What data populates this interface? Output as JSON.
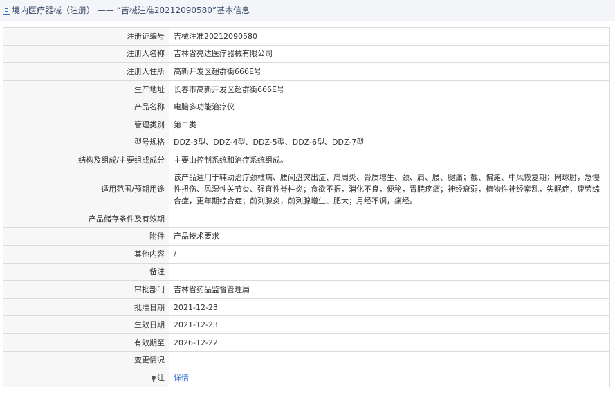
{
  "header": {
    "section": "境内医疗器械（注册）",
    "separator": "——",
    "title": "“吉械注准20212090580”基本信息"
  },
  "rows": [
    {
      "label": "注册证编号",
      "value": "吉械注准20212090580"
    },
    {
      "label": "注册人名称",
      "value": "吉林省亮达医疗器械有限公司"
    },
    {
      "label": "注册人住所",
      "value": "高新开发区超群街666E号"
    },
    {
      "label": "生产地址",
      "value": "长春市高新开发区超群街666E号"
    },
    {
      "label": "产品名称",
      "value": "电脑多功能治疗仪"
    },
    {
      "label": "管理类别",
      "value": "第二类"
    },
    {
      "label": "型号规格",
      "value": "DDZ-3型、DDZ-4型、DDZ-5型、DDZ-6型、DDZ-7型"
    },
    {
      "label": "结构及组成/主要组成成分",
      "value": "主要由控制系统和治疗系统组成。"
    },
    {
      "label": "适用范围/预期用途",
      "value": "该产品适用于辅助治疗颈椎病、腰间盘突出症、肩周炎、骨质增生、颈、肩、腰、腿痛；截、偏瘫、中风恢复期；网球肘，急慢性扭伤、风湿性关节炎、强直性脊柱炎；食欲不振，消化不良，便秘，胃脘疼痛；神经衰弱，植物性神经紊乱，失眠症，疲劳综合症，更年期综合症；前列腺炎，前列腺增生、肥大；月经不调，痛经。"
    },
    {
      "label": "产品储存条件及有效期",
      "value": ""
    },
    {
      "label": "附件",
      "value": "产品技术要求"
    },
    {
      "label": "其他内容",
      "value": "/"
    },
    {
      "label": "备注",
      "value": ""
    },
    {
      "label": "审批部门",
      "value": "吉林省药品监督管理局"
    },
    {
      "label": "批准日期",
      "value": "2021-12-23"
    },
    {
      "label": "生效日期",
      "value": "2021-12-23"
    },
    {
      "label": "有效期至",
      "value": "2026-12-22"
    },
    {
      "label": "变更情况",
      "value": ""
    }
  ],
  "note": {
    "label": "注",
    "link": "详情",
    "icon": "pin-icon"
  }
}
